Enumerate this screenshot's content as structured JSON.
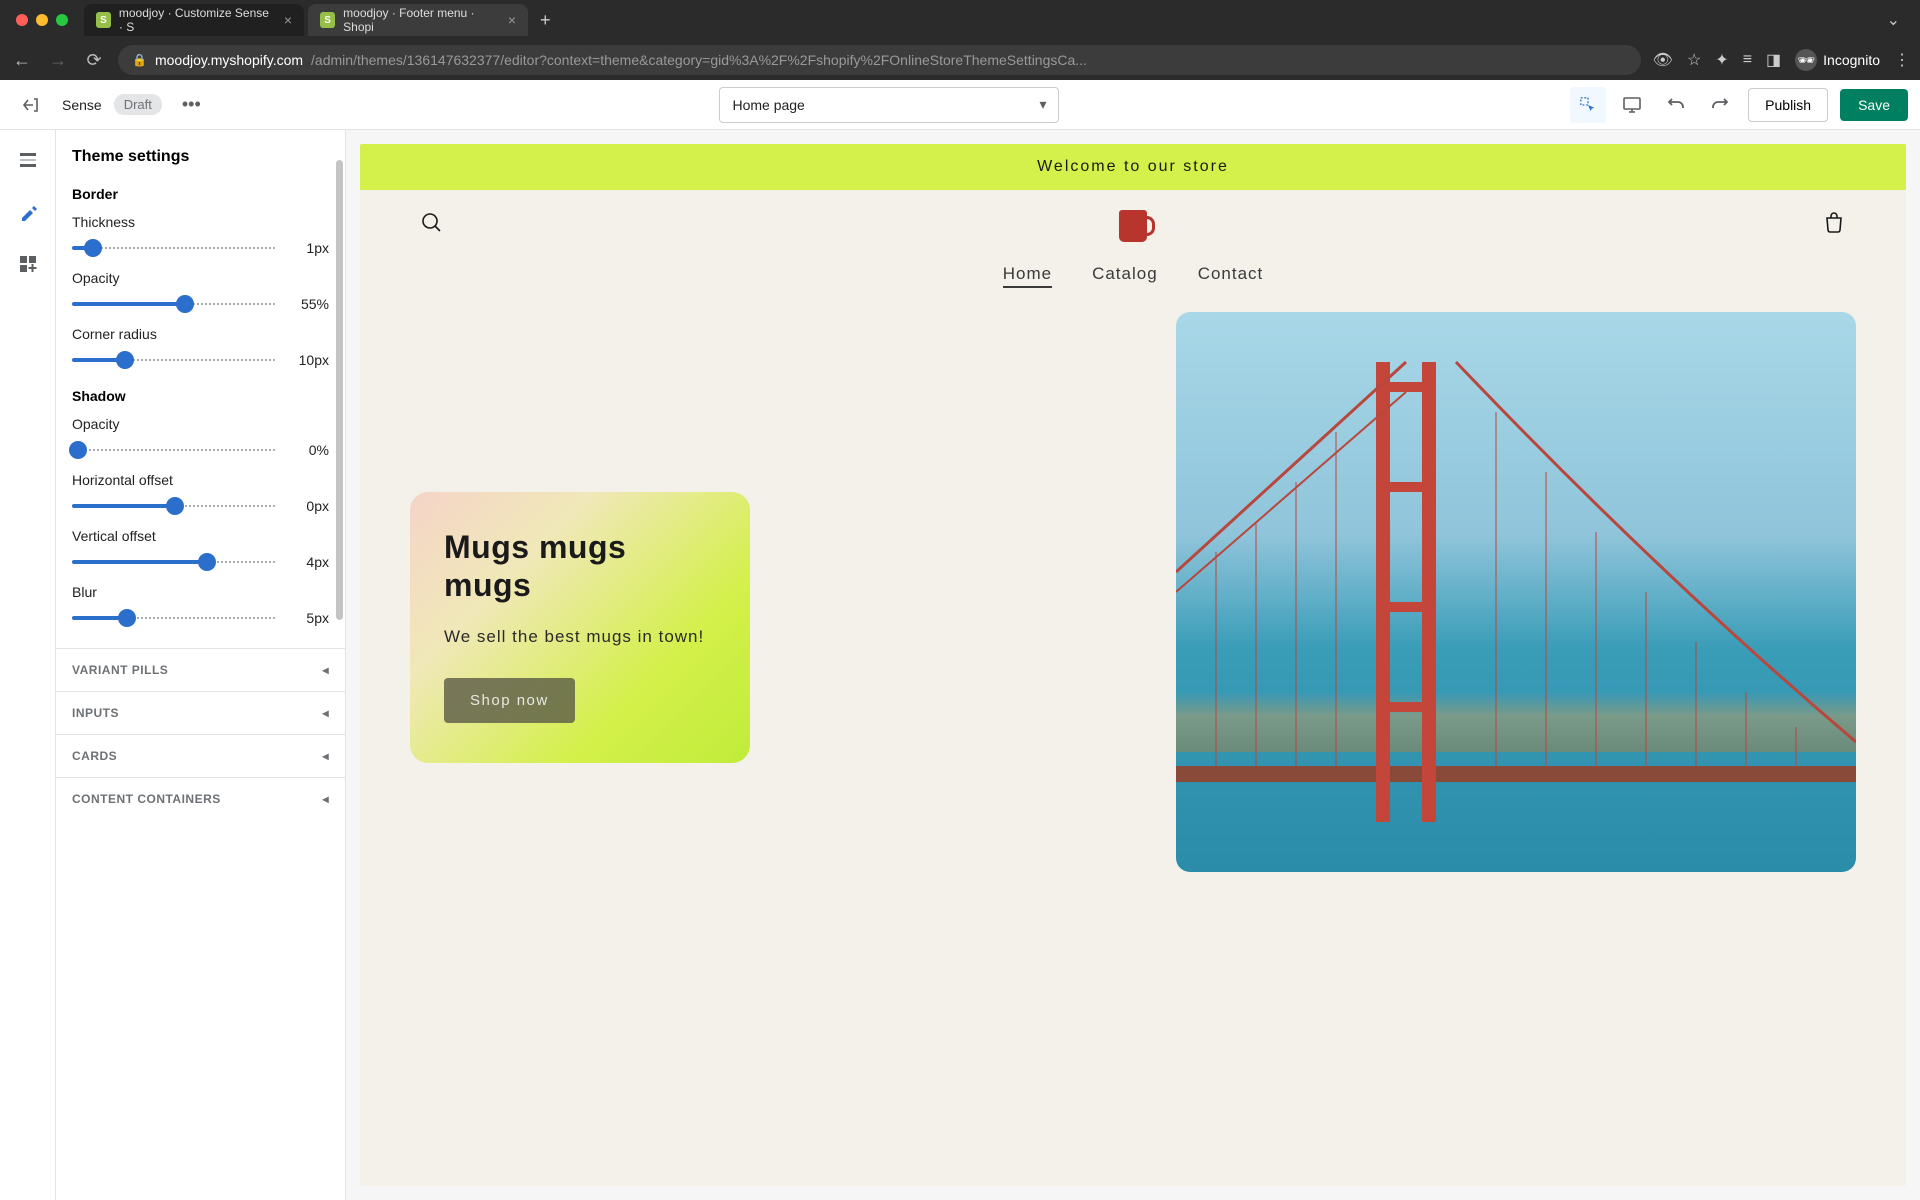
{
  "browser": {
    "tabs": [
      {
        "title": "moodjoy · Customize Sense · S",
        "active": true
      },
      {
        "title": "moodjoy · Footer menu · Shopi",
        "active": false
      }
    ],
    "url_host": "moodjoy.myshopify.com",
    "url_path": "/admin/themes/136147632377/editor?context=theme&category=gid%3A%2F%2Fshopify%2FOnlineStoreThemeSettingsCa...",
    "incognito_label": "Incognito"
  },
  "app_bar": {
    "theme_name": "Sense",
    "status_badge": "Draft",
    "page_selector": "Home page",
    "publish_label": "Publish",
    "save_label": "Save"
  },
  "settings": {
    "title": "Theme settings",
    "border_section": "Border",
    "shadow_section": "Shadow",
    "controls": {
      "thickness_label": "Thickness",
      "thickness_value": "1px",
      "thickness_pct": 10,
      "opacity_label": "Opacity",
      "opacity_value": "55%",
      "opacity_pct": 55,
      "radius_label": "Corner radius",
      "radius_value": "10px",
      "radius_pct": 26,
      "sh_opacity_label": "Opacity",
      "sh_opacity_value": "0%",
      "sh_opacity_pct": 0,
      "hoff_label": "Horizontal offset",
      "hoff_value": "0px",
      "hoff_pct": 50,
      "voff_label": "Vertical offset",
      "voff_value": "4px",
      "voff_pct": 66,
      "blur_label": "Blur",
      "blur_value": "5px",
      "blur_pct": 27
    },
    "collapsed": {
      "variant_pills": "VARIANT PILLS",
      "inputs": "INPUTS",
      "cards": "CARDS",
      "content_containers": "CONTENT CONTAINERS"
    }
  },
  "store": {
    "announcement": "Welcome to our store",
    "nav": {
      "home": "Home",
      "catalog": "Catalog",
      "contact": "Contact"
    },
    "hero": {
      "title": "Mugs mugs mugs",
      "subtitle": "We sell the best mugs in town!",
      "cta": "Shop now"
    }
  }
}
